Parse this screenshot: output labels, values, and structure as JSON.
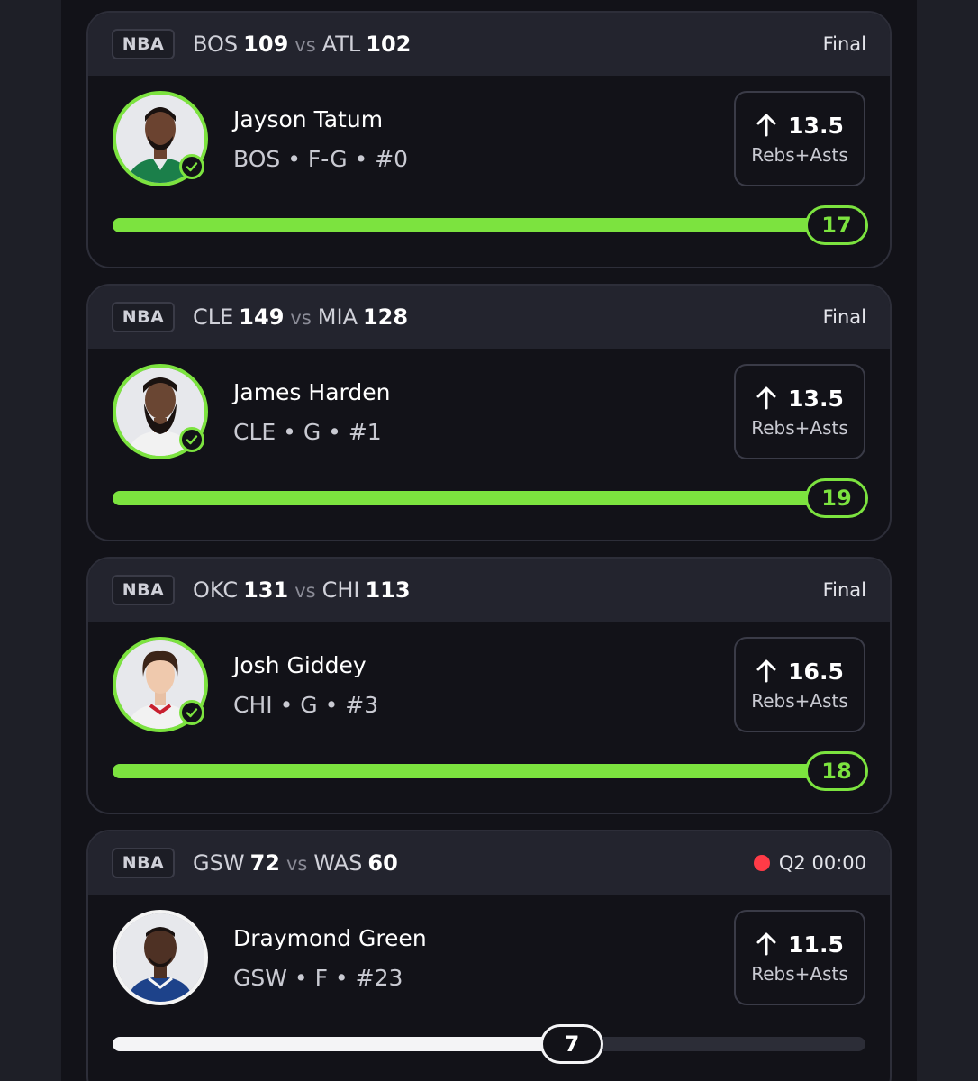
{
  "cards": [
    {
      "league": "NBA",
      "home_team": "BOS",
      "home_score": "109",
      "vs": "vs",
      "away_team": "ATL",
      "away_score": "102",
      "status": "Final",
      "player_name": "Jayson Tatum",
      "player_meta": "BOS • F-G • #0",
      "line_value": "13.5",
      "line_stat": "Rebs+Asts",
      "result": "17",
      "progress_fraction": 1.0
    },
    {
      "league": "NBA",
      "home_team": "CLE",
      "home_score": "149",
      "vs": "vs",
      "away_team": "MIA",
      "away_score": "128",
      "status": "Final",
      "player_name": "James Harden",
      "player_meta": "CLE • G • #1",
      "line_value": "13.5",
      "line_stat": "Rebs+Asts",
      "result": "19",
      "progress_fraction": 1.0
    },
    {
      "league": "NBA",
      "home_team": "OKC",
      "home_score": "131",
      "vs": "vs",
      "away_team": "CHI",
      "away_score": "113",
      "status": "Final",
      "player_name": "Josh Giddey",
      "player_meta": "CHI • G • #3",
      "line_value": "16.5",
      "line_stat": "Rebs+Asts",
      "result": "18",
      "progress_fraction": 1.0
    },
    {
      "league": "NBA",
      "home_team": "GSW",
      "home_score": "72",
      "vs": "vs",
      "away_team": "WAS",
      "away_score": "60",
      "status": "Q2 00:00",
      "player_name": "Draymond Green",
      "player_meta": "GSW • F • #23",
      "line_value": "11.5",
      "line_stat": "Rebs+Asts",
      "result": "7",
      "progress_fraction": 0.61
    }
  ],
  "colors": {
    "hit": "#7ce33f",
    "live": "#ff3b47",
    "pending": "#f4f4f6"
  },
  "icons": {
    "direction": "arrow-up-icon",
    "hit": "check-circle-icon",
    "live": "live-dot-icon"
  }
}
